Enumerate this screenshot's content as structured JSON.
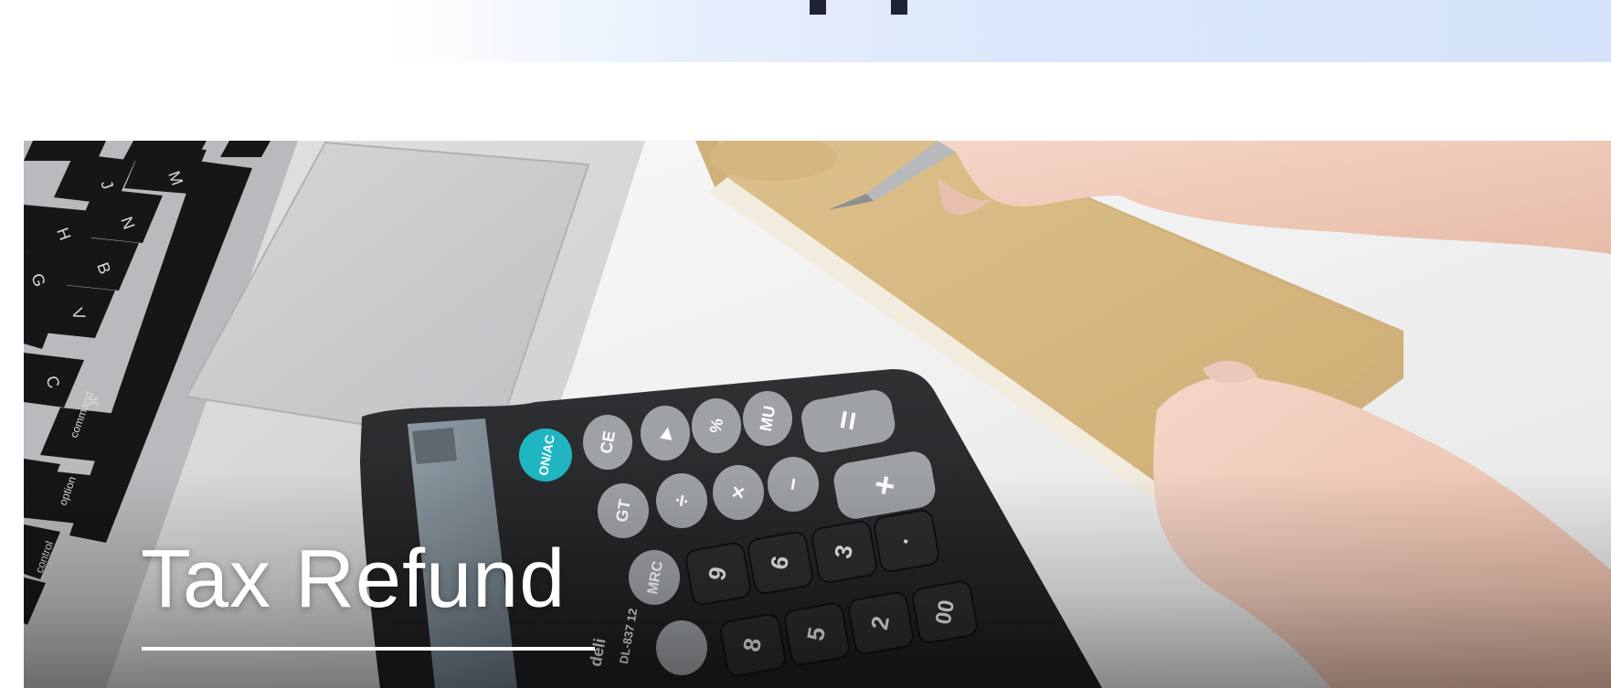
{
  "hero": {
    "title": "Tax Refund"
  },
  "calculator_keys": {
    "onac": "ON/AC",
    "ce": "CE",
    "play": "▶",
    "percent": "%",
    "mu": "MU",
    "equals": "=",
    "gt": "GT",
    "divide": "÷",
    "multiply": "×",
    "minus": "−",
    "plus": "+",
    "mrc": "MRC",
    "nine": "9",
    "six": "6",
    "three": "3",
    "dot": "·",
    "eight": "8",
    "five": "5",
    "two": "2",
    "double_zero": "00"
  },
  "calculator_brand": "deli",
  "calculator_model": "DL-837 12",
  "keyboard_keys": {
    "m": "M",
    "j": "J",
    "n": "N",
    "h": "H",
    "b": "B",
    "g": "G",
    "v": "V",
    "c": "C",
    "command": "command",
    "command_symbol": "⌘",
    "option": "option",
    "control": "control"
  },
  "colors": {
    "banner_start": "#ffffff",
    "banner_end": "#d5e3fa",
    "title_text": "#ffffff",
    "calculator_accent": "#1fb6c2"
  }
}
